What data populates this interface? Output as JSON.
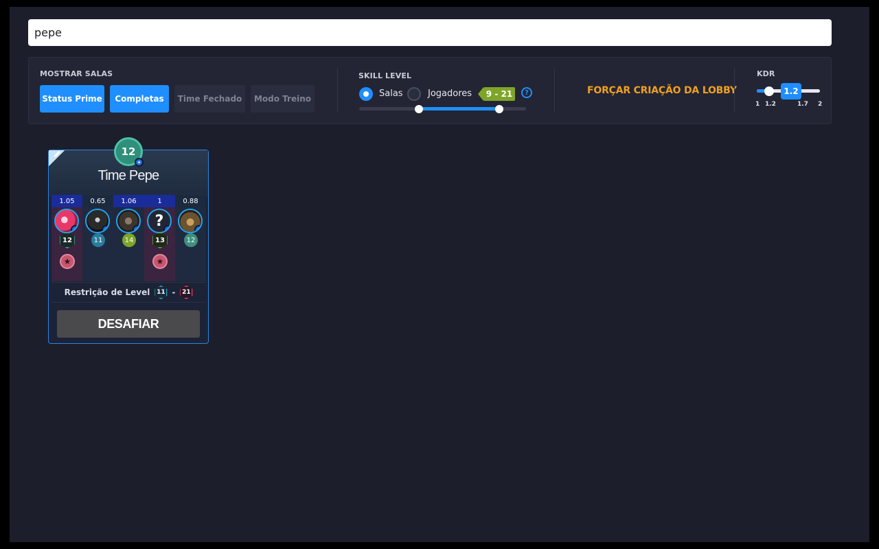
{
  "search": {
    "value": "pepe"
  },
  "show_rooms": {
    "title": "MOSTRAR SALAS",
    "buttons": [
      {
        "label": "Status Prime",
        "active": true
      },
      {
        "label": "Completas",
        "active": true
      },
      {
        "label": "Time Fechado",
        "active": false
      },
      {
        "label": "Modo Treino",
        "active": false
      }
    ]
  },
  "skill_level": {
    "title": "SKILL LEVEL",
    "option_rooms": "Salas",
    "option_players": "Jogadores",
    "selected": "Salas",
    "range_label": "9 - 21",
    "help": "?",
    "range": [
      9,
      21
    ]
  },
  "force_lobby": {
    "label": "FORÇAR CRIAÇÃO DA LOBBY"
  },
  "kdr": {
    "title": "KDR",
    "value": "1.2",
    "ticks": [
      "1",
      "1.2",
      "1.7",
      "2"
    ]
  },
  "lobby_card": {
    "team_level": "12",
    "team_name": "Time Pepe",
    "players": [
      {
        "kdr": "1.05",
        "avatar": "skull-avatar",
        "level": "12",
        "level_style": "hex",
        "starred": true
      },
      {
        "kdr": "0.65",
        "avatar": "hood-avatar",
        "level": "11",
        "level_style": "circle",
        "starred": false
      },
      {
        "kdr": "1.06",
        "avatar": "soldier-avatar",
        "level": "14",
        "level_style": "circle",
        "starred": false
      },
      {
        "kdr": "1",
        "avatar": "?",
        "level": "13",
        "level_style": "hex",
        "starred": true
      },
      {
        "kdr": "0.88",
        "avatar": "dog-avatar",
        "level": "12",
        "level_style": "circle",
        "starred": false
      }
    ],
    "restriction_label": "Restrição de Level",
    "restriction_min": "11",
    "restriction_sep": "-",
    "restriction_max": "21",
    "challenge_label": "DESAFIAR"
  },
  "colors": {
    "accent": "#1f8fff",
    "background": "#1c1e2b",
    "force_lobby": "#f0a020",
    "skill_badge": "#7ea52a"
  }
}
